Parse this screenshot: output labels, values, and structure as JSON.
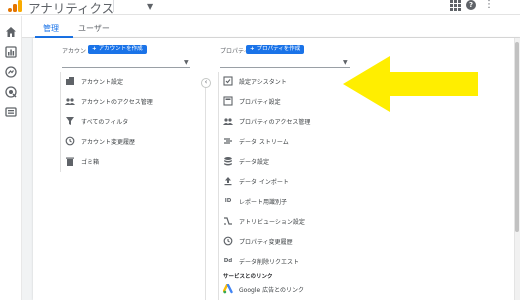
{
  "app": {
    "title": "アナリティクス"
  },
  "topbar": {
    "apps_icon": "apps-grid-icon",
    "help_icon": "help-icon",
    "help_glyph": "?",
    "more_icon": "more-vert-icon",
    "more_glyph": "⋮"
  },
  "tabs": [
    {
      "label": "管理",
      "active": true
    },
    {
      "label": "ユーザー",
      "active": false
    }
  ],
  "account": {
    "label": "アカウント",
    "create_button": "アカウントを作成",
    "items": [
      {
        "label": "アカウント設定",
        "icon": "building-icon"
      },
      {
        "label": "アカウントのアクセス管理",
        "icon": "people-icon"
      },
      {
        "label": "すべてのフィルタ",
        "icon": "filter-icon"
      },
      {
        "label": "アカウント変更履歴",
        "icon": "history-icon"
      },
      {
        "label": "ゴミ箱",
        "icon": "trash-icon"
      }
    ]
  },
  "property": {
    "label": "プロパティ",
    "create_button": "プロパティを作成",
    "items": [
      {
        "label": "設定アシスタント",
        "icon": "checklist-icon"
      },
      {
        "label": "プロパティ設定",
        "icon": "property-settings-icon"
      },
      {
        "label": "プロパティのアクセス管理",
        "icon": "people-icon"
      },
      {
        "label": "データ ストリーム",
        "icon": "stream-icon"
      },
      {
        "label": "データ設定",
        "icon": "database-icon"
      },
      {
        "label": "データ インポート",
        "icon": "upload-icon"
      },
      {
        "label": "レポート用識別子",
        "icon": "id-icon",
        "glyph": "ID"
      },
      {
        "label": "アトリビューション設定",
        "icon": "attribution-icon"
      },
      {
        "label": "プロパティ変更履歴",
        "icon": "history-icon"
      },
      {
        "label": "データ削除リクエスト",
        "icon": "data-delete-icon",
        "glyph": "Dd"
      }
    ],
    "links_heading": "サービスとのリンク",
    "links": [
      {
        "label": "Google 広告とのリンク",
        "icon": "google-ads-icon"
      }
    ]
  },
  "colors": {
    "accent": "#1a73e8",
    "arrow": "#ffee00",
    "logo_orange": "#f9ab00",
    "logo_dark_orange": "#e37400"
  }
}
